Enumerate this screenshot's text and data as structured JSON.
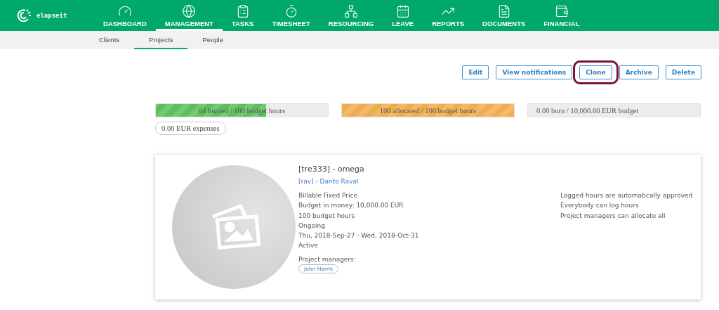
{
  "logo": "elapseit",
  "nav": [
    {
      "label": "DASHBOARD",
      "selected": false
    },
    {
      "label": "MANAGEMENT",
      "selected": true
    },
    {
      "label": "TASKS",
      "selected": false
    },
    {
      "label": "TIMESHEET",
      "selected": false
    },
    {
      "label": "RESOURCING",
      "selected": false
    },
    {
      "label": "LEAVE",
      "selected": false
    },
    {
      "label": "REPORTS",
      "selected": false
    },
    {
      "label": "DOCUMENTS",
      "selected": false
    },
    {
      "label": "FINANCIAL",
      "selected": false
    }
  ],
  "subnav": [
    {
      "label": "Clients",
      "selected": false
    },
    {
      "label": "Projects",
      "selected": true
    },
    {
      "label": "People",
      "selected": false
    }
  ],
  "actions": [
    {
      "label": "Edit",
      "highlighted": false
    },
    {
      "label": "View notifications",
      "highlighted": false
    },
    {
      "label": "Clone",
      "highlighted": true
    },
    {
      "label": "Archive",
      "highlighted": false
    },
    {
      "label": "Delete",
      "highlighted": false
    }
  ],
  "meters": [
    {
      "kind": "burned",
      "text": "64 burned / 100 budget hours",
      "level": 0.64
    },
    {
      "kind": "allocated",
      "text": "100 allocated / 100 budget hours",
      "level": 1
    },
    {
      "kind": "money",
      "text": "0.00 burn / 10,000.00 EUR budget",
      "level": 0
    }
  ],
  "expenses": "0.00 EUR expenses",
  "project": {
    "title": "[tre333] - omega",
    "client": "[rav] - Danto Raval",
    "details": [
      "Billable Fixed Price",
      "Budget in money: 10,000.00 EUR",
      "100 budget hours",
      "Ongoing",
      "Thu, 2018-Sep-27 - Wed, 2018-Oct-31",
      "Active"
    ],
    "managers_label": "Project managers:",
    "managers": [
      "John Harris"
    ],
    "settings": [
      "Logged hours are automatically approved",
      "Everybody can log hours",
      "Project managers can allocate all"
    ]
  }
}
